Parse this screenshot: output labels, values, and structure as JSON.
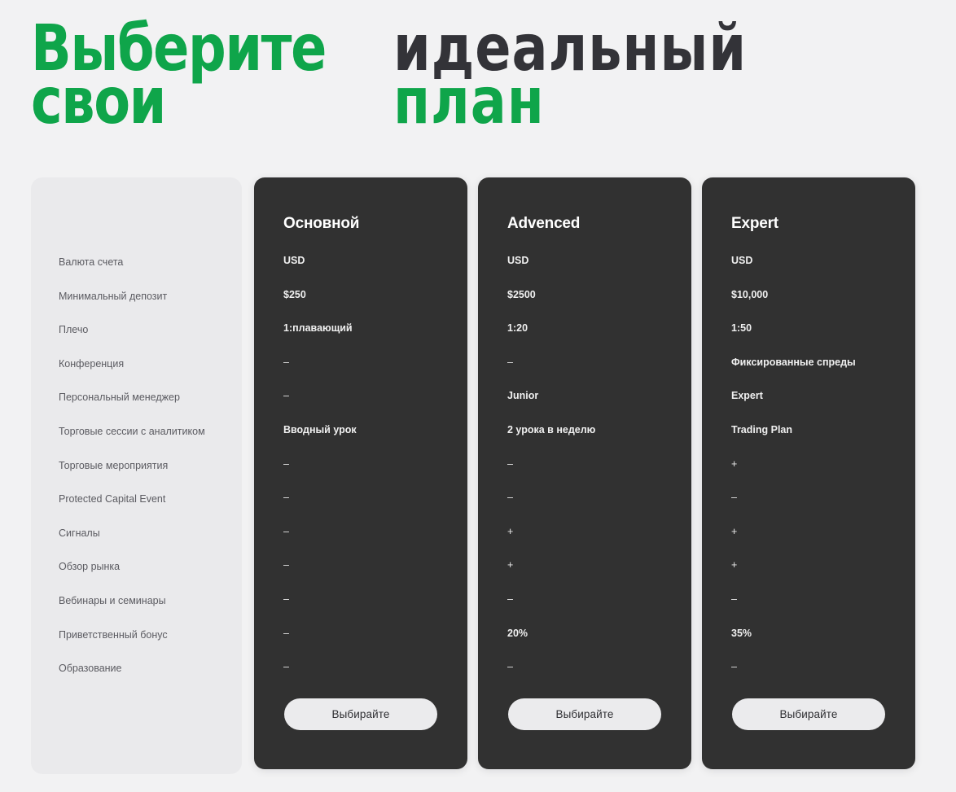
{
  "heading": {
    "left_line1": "Выберите",
    "left_line2": "свои",
    "right_line1": "идеальный",
    "right_line2": "план",
    "green_color": "#0fa54a",
    "dark_color": "#333338"
  },
  "theme": {
    "page_background": "#f2f2f3",
    "label_panel_background": "#eaeaec",
    "card_background": "#313131",
    "button_background": "#ebebed",
    "label_text_color": "#5b5b61",
    "value_text_color": "#f0f0f0"
  },
  "features": [
    "Валюта счета",
    "Минимальный депозит",
    "Плечо",
    "Конференция",
    "Персональный менеджер",
    "Торговые сессии с аналитиком",
    "Торговые мероприятия",
    "Protected Capital Event",
    "Сигналы",
    "Обзор рынка",
    "Вебинары и семинары",
    "Приветственный бонус",
    "Образование"
  ],
  "plans": [
    {
      "name": "Основной",
      "button_label": "Выбирайте",
      "values": [
        "USD",
        "$250",
        "1:плавающий",
        "–",
        "–",
        "Вводный урок",
        "–",
        "–",
        "–",
        "–",
        "–",
        "–",
        "–"
      ]
    },
    {
      "name": "Advenced",
      "button_label": "Выбирайте",
      "values": [
        "USD",
        "$2500",
        "1:20",
        "–",
        "Junior",
        "2 урока в неделю",
        "–",
        "–",
        "+",
        "+",
        "–",
        "20%",
        "–"
      ]
    },
    {
      "name": "Expert",
      "button_label": "Выбирайте",
      "values": [
        "USD",
        "$10,000",
        "1:50",
        "Фиксированные спреды",
        "Expert",
        "Trading Plan",
        "+",
        "–",
        "+",
        "+",
        "–",
        "35%",
        "–"
      ]
    }
  ]
}
